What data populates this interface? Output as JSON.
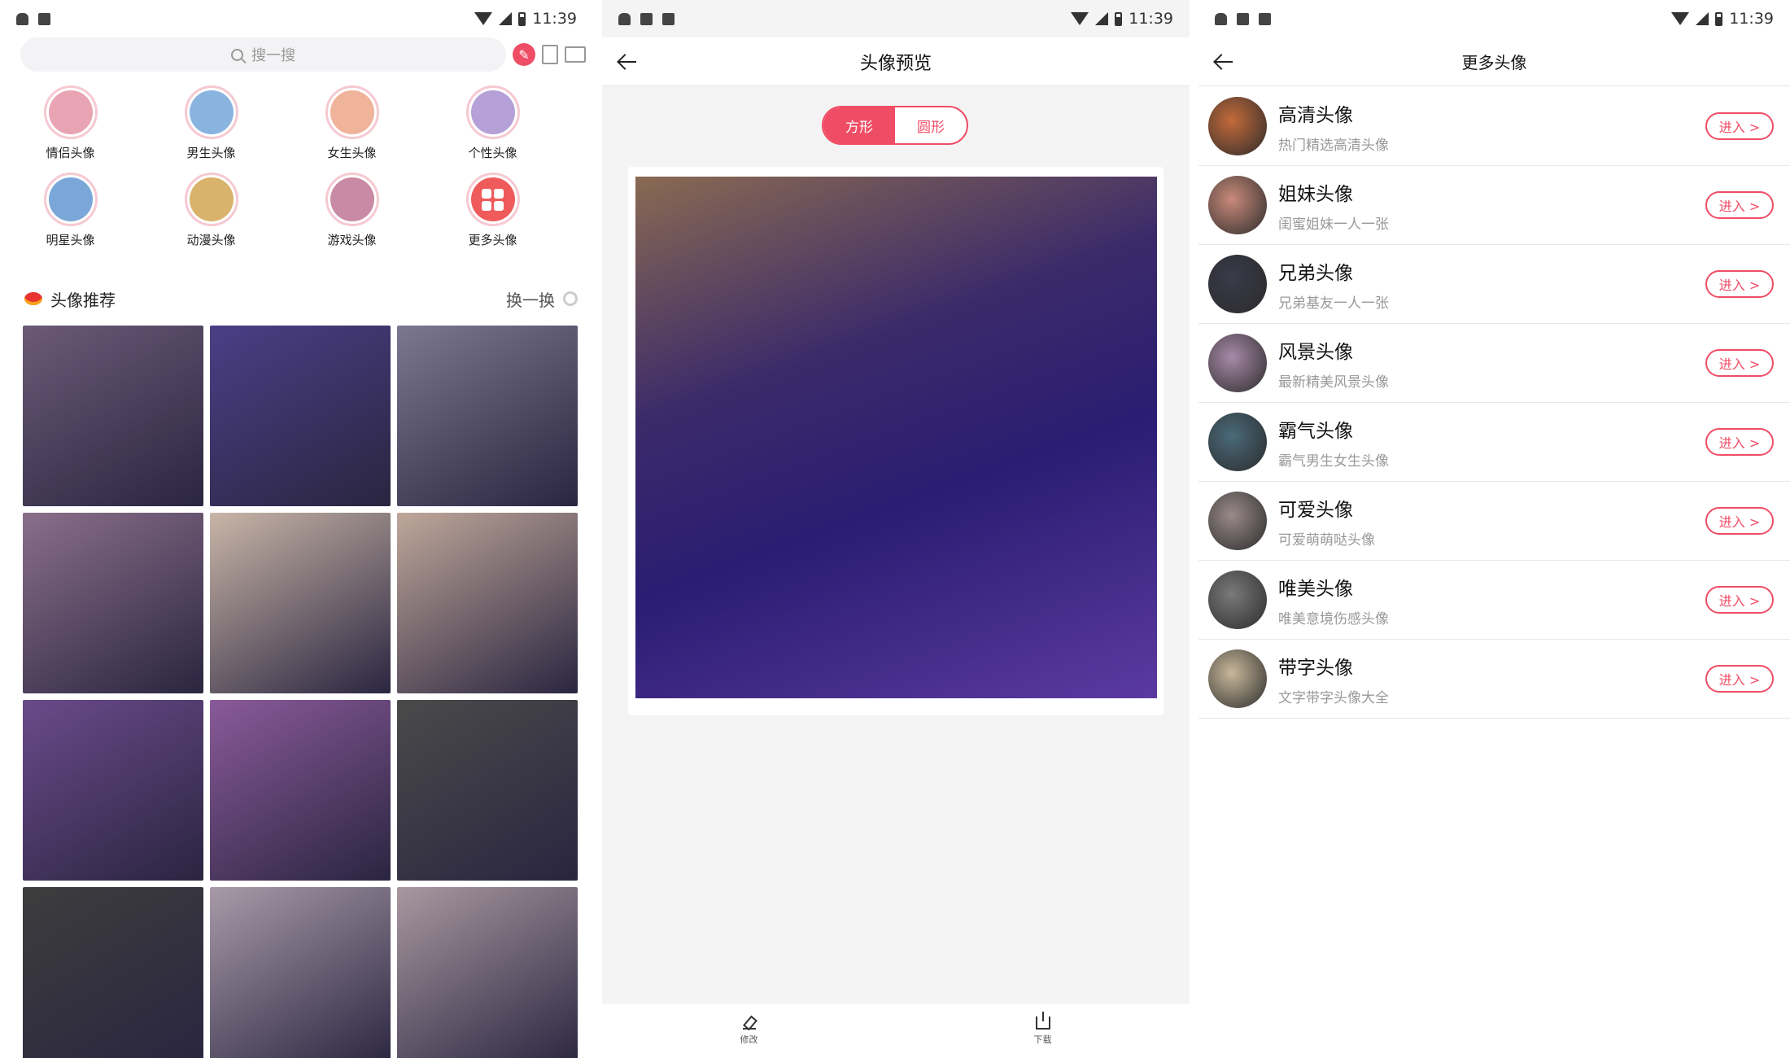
{
  "status_bar": {
    "time": "11:39"
  },
  "screen1": {
    "search_placeholder": "搜一搜",
    "categories": [
      {
        "label": "情侣头像",
        "color": "#e9a4b3"
      },
      {
        "label": "男生头像",
        "color": "#8ab4e0"
      },
      {
        "label": "女生头像",
        "color": "#f0b49a"
      },
      {
        "label": "个性头像",
        "color": "#b6a0d8"
      },
      {
        "label": "明星头像",
        "color": "#7aa7d8"
      },
      {
        "label": "动漫头像",
        "color": "#d9b36c"
      },
      {
        "label": "游戏头像",
        "color": "#c98aa6"
      },
      {
        "label": "更多头像",
        "color": "#ef5b5b"
      }
    ],
    "recommend_title": "头像推荐",
    "refresh_label": "换一换",
    "photos": [
      {
        "color": "#6b5a78"
      },
      {
        "color": "#4a3f86"
      },
      {
        "color": "#7b7890"
      },
      {
        "color": "#8a6f8a"
      },
      {
        "color": "#c9b6a8"
      },
      {
        "color": "#bfa79a"
      },
      {
        "color": "#6a4a8a"
      },
      {
        "color": "#8a5a9a"
      },
      {
        "color": "#4a4a4a"
      },
      {
        "color": "#3d3d3d"
      },
      {
        "color": "#a89aa8"
      },
      {
        "color": "#a898a0"
      }
    ]
  },
  "screen2": {
    "title": "头像预览",
    "shape_square": "方形",
    "shape_round": "圆形",
    "edit_label": "修改",
    "download_label": "下载"
  },
  "screen3": {
    "title": "更多头像",
    "enter_label": "进入 >",
    "items": [
      {
        "title": "高清头像",
        "subtitle": "热门精选高清头像",
        "color": "#c46a3a"
      },
      {
        "title": "姐妹头像",
        "subtitle": "闺蜜姐妹一人一张",
        "color": "#c98a7a"
      },
      {
        "title": "兄弟头像",
        "subtitle": "兄弟基友一人一张",
        "color": "#3a3a4a"
      },
      {
        "title": "风景头像",
        "subtitle": "最新精美风景头像",
        "color": "#a88aa8"
      },
      {
        "title": "霸气头像",
        "subtitle": "霸气男生女生头像",
        "color": "#4a6a7a"
      },
      {
        "title": "可爱头像",
        "subtitle": "可爱萌萌哒头像",
        "color": "#9a8a8a"
      },
      {
        "title": "唯美头像",
        "subtitle": "唯美意境伤感头像",
        "color": "#7a7a7a"
      },
      {
        "title": "带字头像",
        "subtitle": "文字带字头像大全",
        "color": "#c8b89a"
      }
    ]
  }
}
